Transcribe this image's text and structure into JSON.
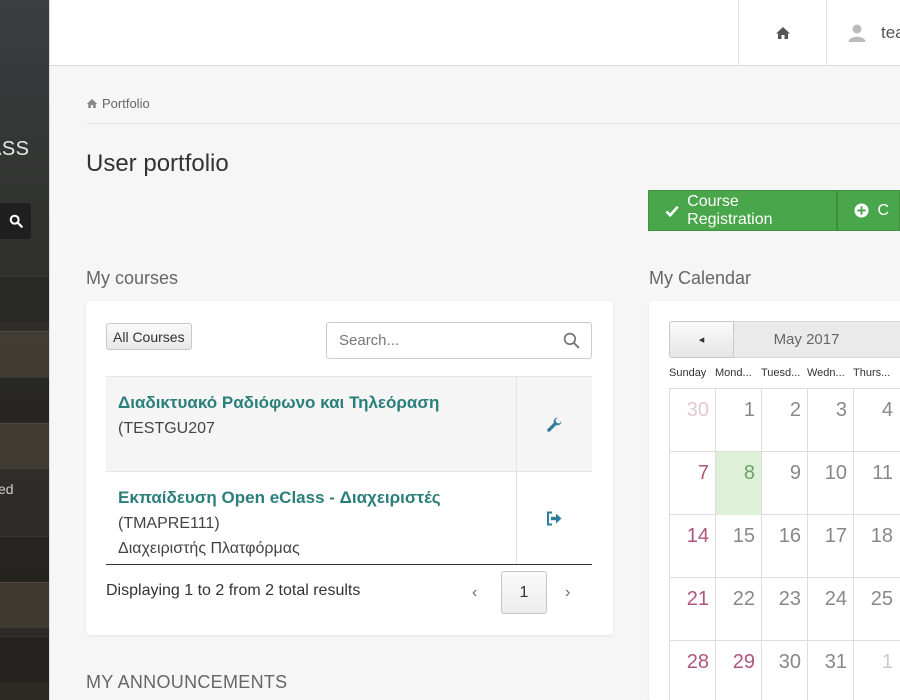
{
  "sidebar": {
    "logo_text": "ASS",
    "item_label": "ed"
  },
  "topbar": {
    "user_label": "tea"
  },
  "breadcrumb": {
    "label": "Portfolio"
  },
  "page": {
    "title": "User portfolio"
  },
  "actions": {
    "course_registration": "Course Registration",
    "second_button": "C"
  },
  "courses": {
    "heading": "My courses",
    "filter_button": "All Courses",
    "search_placeholder": "Search...",
    "rows": [
      {
        "name": "Διαδικτυακό Ραδιόφωνο και Τηλεόραση",
        "code": "(TESTGU207",
        "professor": "",
        "action_icon": "wrench-icon"
      },
      {
        "name": "Εκπαίδευση Open eClass - Διαχειριστές",
        "code": "(TMAPRE111)",
        "professor": "Διαχειριστής Πλατφόρμας",
        "action_icon": "sign-out-icon"
      }
    ],
    "pagination": {
      "summary": "Displaying 1 to 2 from 2 total results",
      "prev": "‹",
      "current_page": "1",
      "next": "›"
    }
  },
  "calendar": {
    "heading": "My Calendar",
    "month": "May 2017",
    "prev_symbol": "◂",
    "days_of_week": [
      "Sunday",
      "Mond...",
      "Tuesd...",
      "Wedn...",
      "Thurs..."
    ],
    "weeks": [
      [
        "30",
        "1",
        "2",
        "3",
        "4"
      ],
      [
        "7",
        "8",
        "9",
        "10",
        "11"
      ],
      [
        "14",
        "15",
        "16",
        "17",
        "18"
      ],
      [
        "21",
        "22",
        "23",
        "24",
        "25"
      ],
      [
        "28",
        "29",
        "30",
        "31",
        "1"
      ]
    ],
    "today": "8"
  },
  "announcements": {
    "heading": "MY ANNOUNCEMENTS"
  },
  "colors": {
    "accent_green": "#4aa64a",
    "course_link": "#2b7f7a",
    "today_bg": "#dff0d8",
    "sunday": "#b0567a"
  }
}
